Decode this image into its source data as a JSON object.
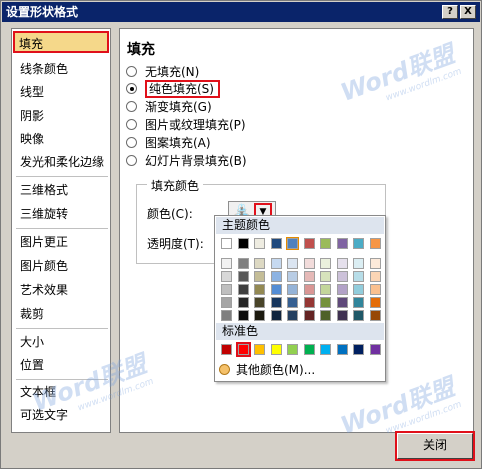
{
  "window": {
    "title": "设置形状格式",
    "help_btn": "?",
    "close_btn": "X"
  },
  "sidebar": {
    "items": [
      {
        "label": "填充",
        "selected": true
      },
      {
        "label": "线条颜色"
      },
      {
        "label": "线型"
      },
      {
        "label": "阴影"
      },
      {
        "label": "映像"
      },
      {
        "label": "发光和柔化边缘"
      },
      {
        "label": "三维格式"
      },
      {
        "label": "三维旋转"
      },
      {
        "label": "图片更正"
      },
      {
        "label": "图片颜色"
      },
      {
        "label": "艺术效果"
      },
      {
        "label": "裁剪"
      },
      {
        "label": "大小"
      },
      {
        "label": "位置"
      },
      {
        "label": "文本框"
      },
      {
        "label": "可选文字"
      }
    ]
  },
  "main": {
    "heading": "填充",
    "options": [
      {
        "label": "无填充(N)",
        "checked": false
      },
      {
        "label": "纯色填充(S)",
        "checked": true
      },
      {
        "label": "渐变填充(G)",
        "checked": false
      },
      {
        "label": "图片或纹理填充(P)",
        "checked": false
      },
      {
        "label": "图案填充(A)",
        "checked": false
      },
      {
        "label": "幻灯片背景填充(B)",
        "checked": false
      }
    ],
    "fill_group": {
      "title": "填充颜色",
      "color_label": "颜色(C):",
      "transparency_label": "透明度(T):"
    }
  },
  "palette": {
    "theme_header": "主题颜色",
    "standard_header": "标准色",
    "more_colors": "其他颜色(M)...",
    "theme_top": [
      "#ffffff",
      "#000000",
      "#eeece1",
      "#1f497d",
      "#4f81bd",
      "#c0504d",
      "#9bbb59",
      "#8064a2",
      "#4bacc6",
      "#f79646"
    ],
    "theme_shades": [
      [
        "#f2f2f2",
        "#7f7f7f",
        "#ddd9c3",
        "#c6d9f0",
        "#dbe5f1",
        "#f2dcdb",
        "#ebf1dd",
        "#e5e0ec",
        "#dbeef3",
        "#fdeada"
      ],
      [
        "#d8d8d8",
        "#595959",
        "#c4bd97",
        "#8db3e2",
        "#b8cce4",
        "#e5b9b7",
        "#d7e3bc",
        "#ccc1d9",
        "#b7dde8",
        "#fbd5b5"
      ],
      [
        "#bfbfbf",
        "#3f3f3f",
        "#938953",
        "#548dd4",
        "#95b3d7",
        "#d99694",
        "#c3d69b",
        "#b2a2c7",
        "#92cddc",
        "#fac08f"
      ],
      [
        "#a5a5a5",
        "#262626",
        "#494429",
        "#17365d",
        "#366092",
        "#953734",
        "#76923c",
        "#5f497a",
        "#31859b",
        "#e36c09"
      ],
      [
        "#7f7f7f",
        "#0c0c0c",
        "#1d1b10",
        "#0f243e",
        "#244061",
        "#632423",
        "#4f6128",
        "#3f3151",
        "#205867",
        "#974806"
      ]
    ],
    "standard": [
      "#c00000",
      "#ff0000",
      "#ffc000",
      "#ffff00",
      "#92d050",
      "#00b050",
      "#00b0f0",
      "#0070c0",
      "#002060",
      "#7030a0"
    ]
  },
  "footer": {
    "close_label": "关闭"
  },
  "watermark": {
    "text": "Word联盟",
    "url": "www.wordlm.com"
  }
}
